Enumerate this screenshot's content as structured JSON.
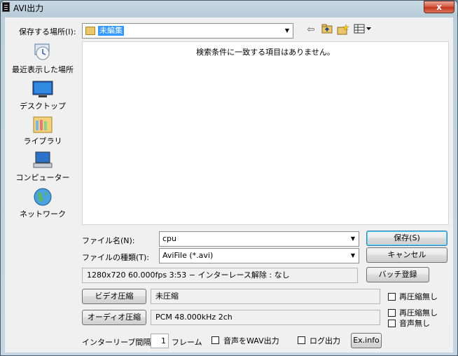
{
  "window": {
    "title": "AVI出力",
    "close_glyph": "x"
  },
  "save_location": {
    "label": "保存する場所(I):",
    "current_folder": "未編集"
  },
  "toolbar": {
    "icons": [
      "back-arrow-icon",
      "up-folder-icon",
      "new-folder-icon",
      "view-menu-icon"
    ]
  },
  "places": [
    {
      "label": "最近表示した場所",
      "icon": "recent-places-icon"
    },
    {
      "label": "デスクトップ",
      "icon": "desktop-icon"
    },
    {
      "label": "ライブラリ",
      "icon": "libraries-icon"
    },
    {
      "label": "コンピューター",
      "icon": "computer-icon"
    },
    {
      "label": "ネットワーク",
      "icon": "network-icon"
    }
  ],
  "file_list": {
    "empty_message": "検索条件に一致する項目はありません。"
  },
  "filename": {
    "label": "ファイル名(N):",
    "value": "cpu"
  },
  "filetype": {
    "label": "ファイルの種類(T):",
    "value": "AviFile (*.avi)"
  },
  "buttons": {
    "save": "保存(S)",
    "cancel": "キャンセル",
    "batch": "バッチ登録",
    "video_compress": "ビデオ圧縮",
    "audio_compress": "オーディオ圧縮",
    "exinfo": "Ex.info"
  },
  "video_info": "1280x720  60.000fps  3:53  −  インターレース解除 : なし",
  "video_codec": "未圧縮",
  "audio_codec": "PCM 48.000kHz 2ch",
  "checkboxes": {
    "video_no_recompress": "再圧縮無し",
    "audio_no_recompress": "再圧縮無し",
    "no_audio": "音声無し",
    "wav_output": "音声をWAV出力",
    "log_output": "ログ出力"
  },
  "interleave": {
    "label": "インターリーブ間隔 :",
    "value": "1",
    "unit": "フレーム"
  }
}
